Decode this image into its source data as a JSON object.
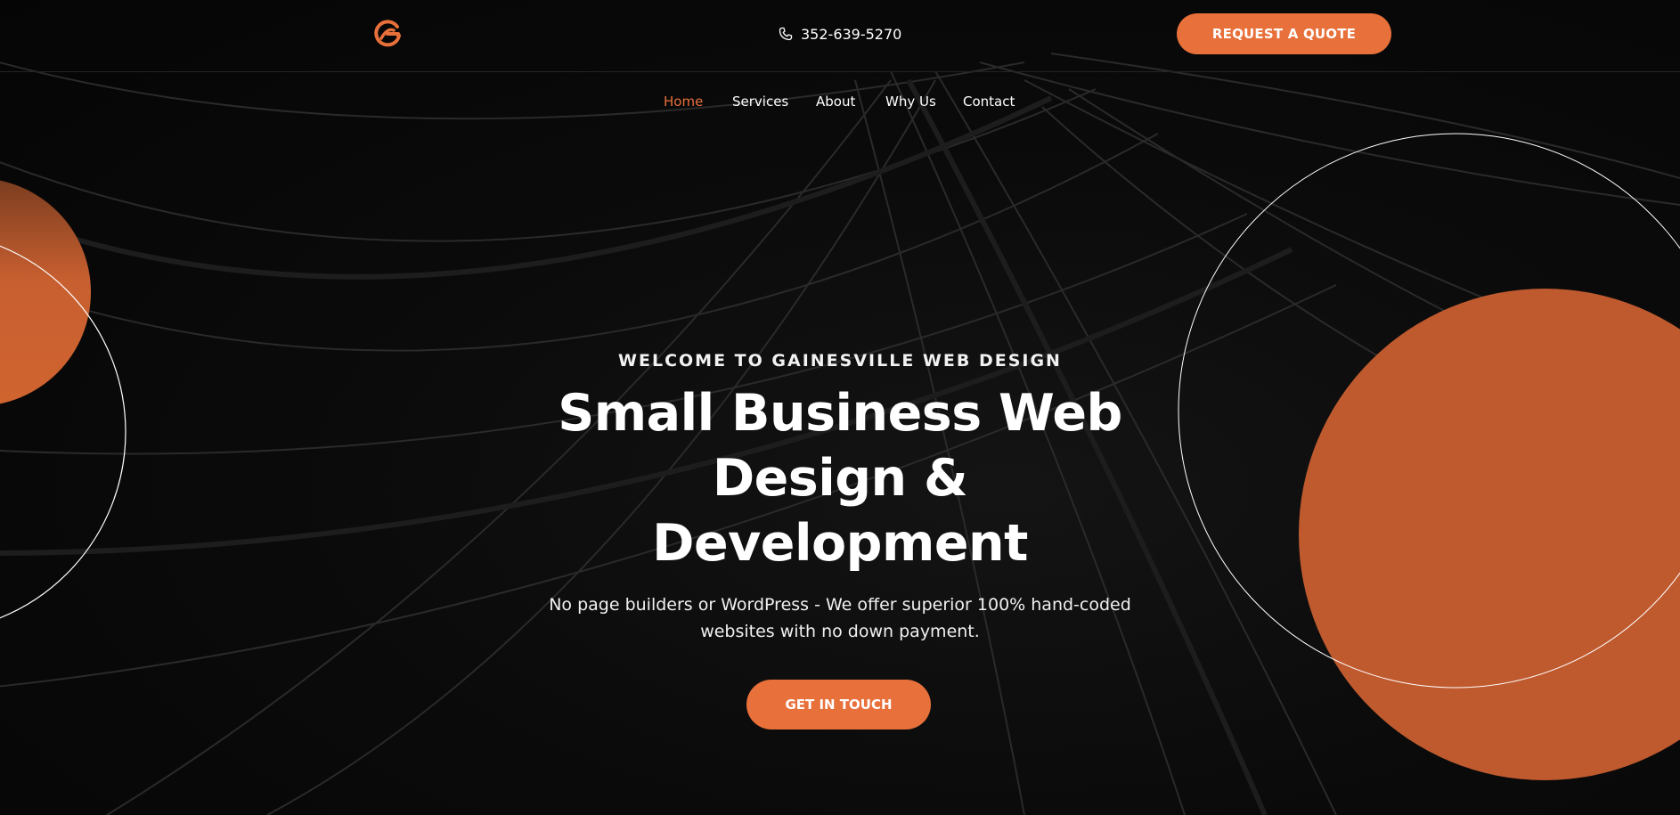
{
  "colors": {
    "accent": "#e8703a",
    "background": "#070707",
    "text": "#ffffff"
  },
  "header": {
    "logo_icon": "g-logo-icon",
    "phone_icon": "phone-icon",
    "phone": "352-639-5270",
    "quote_button": "REQUEST A QUOTE"
  },
  "nav": {
    "items": [
      {
        "label": "Home",
        "active": true
      },
      {
        "label": "Services",
        "active": false
      },
      {
        "label": "About",
        "active": false
      },
      {
        "label": "Why Us",
        "active": false
      },
      {
        "label": "Contact",
        "active": false
      }
    ]
  },
  "hero": {
    "eyebrow": "WELCOME TO GAINESVILLE WEB DESIGN",
    "headline": "Small Business Web Design & Development",
    "subtext": "No page builders or WordPress - We offer superior 100% hand-coded websites with no down payment.",
    "cta": "GET IN TOUCH"
  }
}
